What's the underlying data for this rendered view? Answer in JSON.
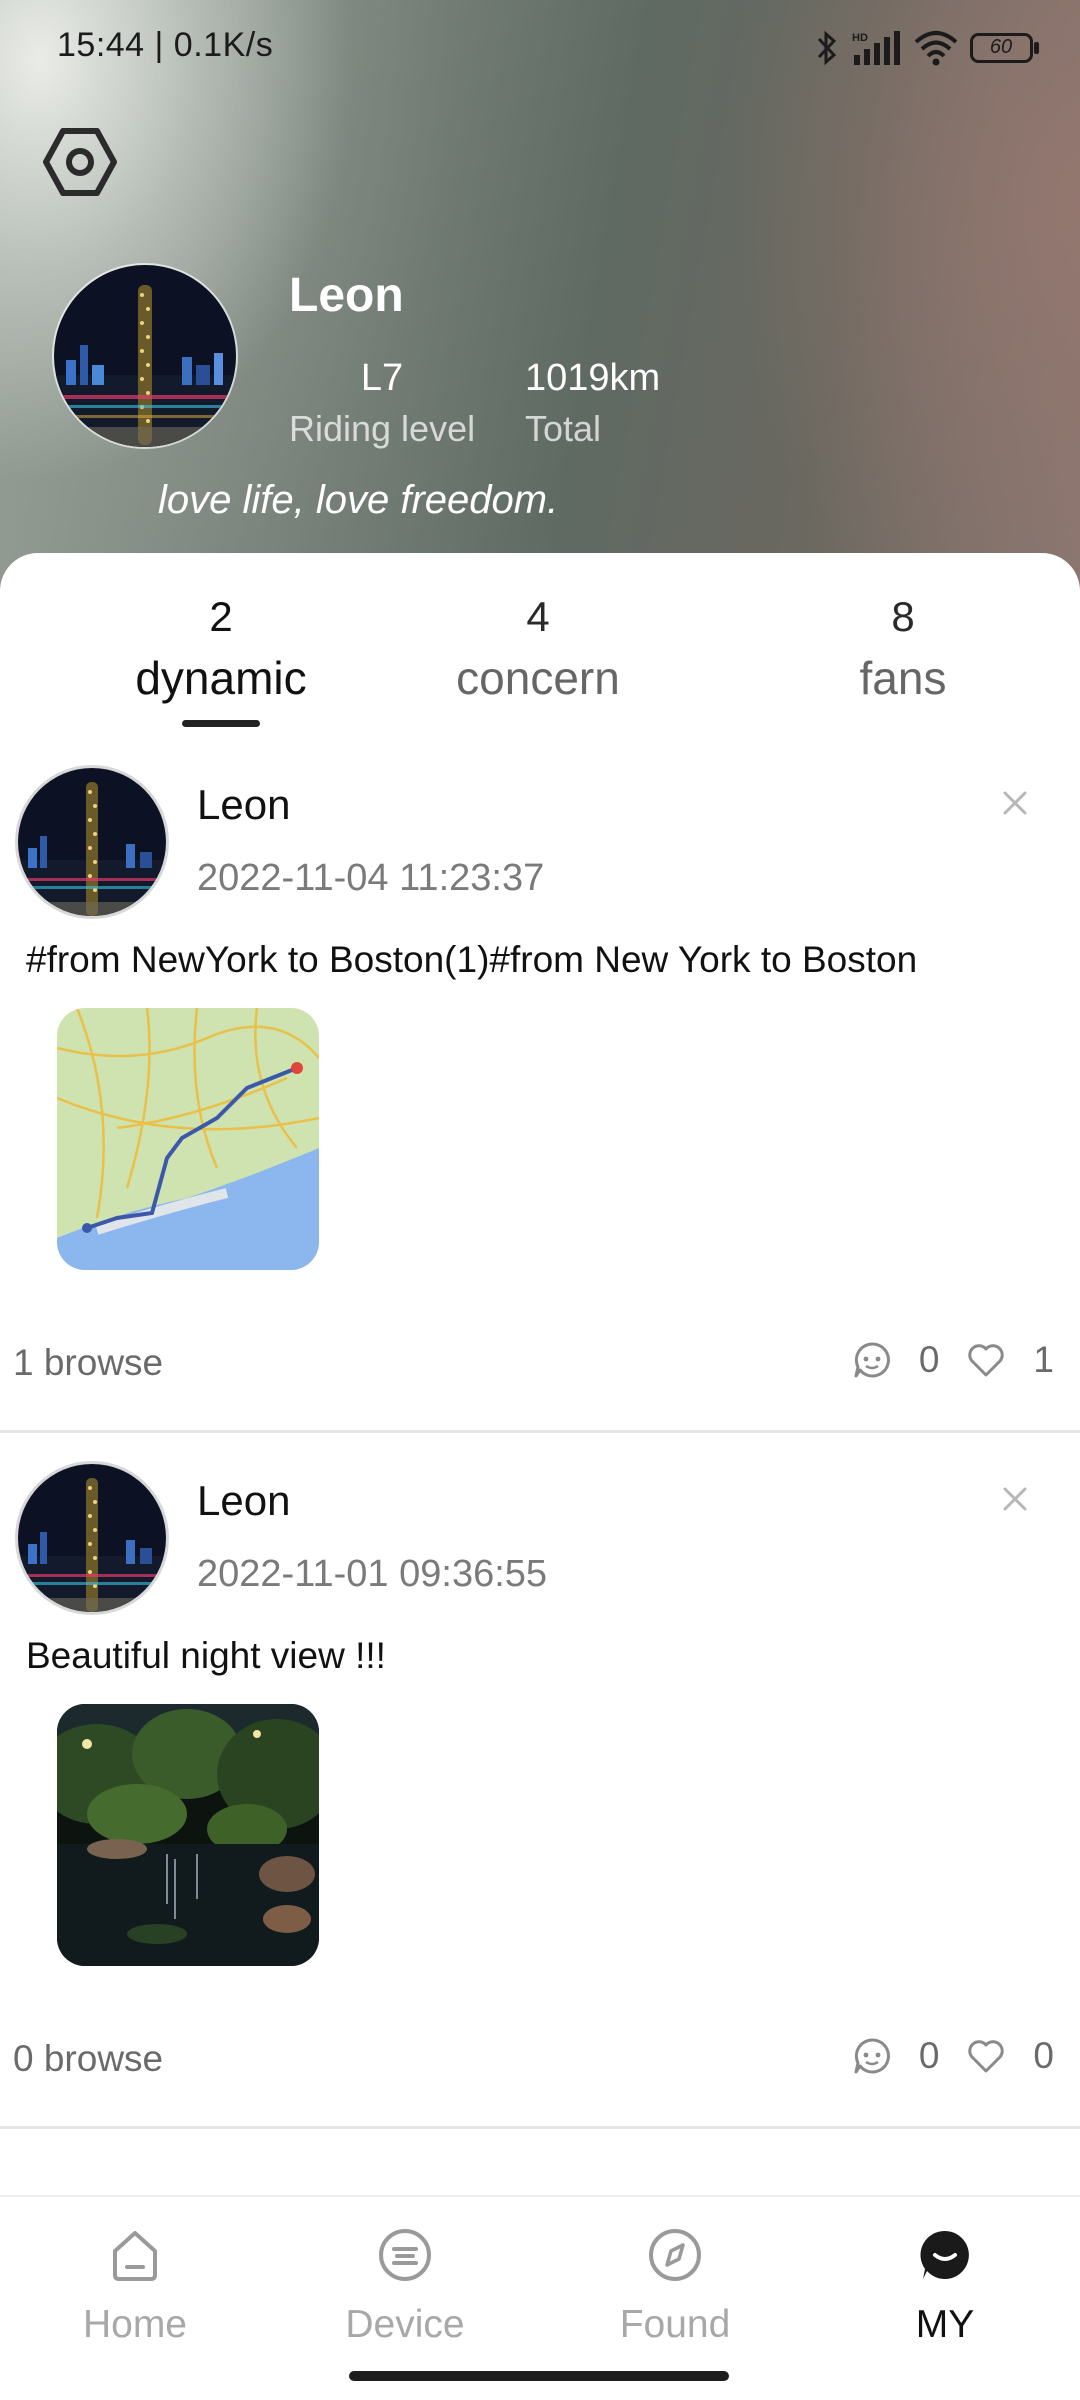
{
  "status_bar": {
    "time_speed": "15:44 | 0.1K/s",
    "battery": "60",
    "icons": [
      "bluetooth-icon",
      "hd-signal-icon",
      "wifi-icon",
      "battery-icon"
    ]
  },
  "header": {
    "settings_icon": "settings-hexagon-icon",
    "name": "Leon",
    "riding_level_value": "L7",
    "riding_level_label": "Riding level",
    "total_value": "1019km",
    "total_label": "Total",
    "bio": "love life, love freedom."
  },
  "tabs": [
    {
      "count": "2",
      "label": "dynamic",
      "active": true
    },
    {
      "count": "4",
      "label": "concern",
      "active": false
    },
    {
      "count": "8",
      "label": "fans",
      "active": false
    }
  ],
  "posts": [
    {
      "user": "Leon",
      "time": "2022-11-04 11:23:37",
      "text": "#from NewYork to Boston(1)#from New York to Boston",
      "image": "route-map-image",
      "browse": "1 browse",
      "comments": "0",
      "likes": "1"
    },
    {
      "user": "Leon",
      "time": "2022-11-01 09:36:55",
      "text": "Beautiful night view !!!",
      "image": "night-garden-pond-image",
      "browse": "0 browse",
      "comments": "0",
      "likes": "0"
    }
  ],
  "bottom_nav": [
    {
      "label": "Home",
      "icon": "home-icon",
      "active": false
    },
    {
      "label": "Device",
      "icon": "device-icon",
      "active": false
    },
    {
      "label": "Found",
      "icon": "compass-icon",
      "active": false
    },
    {
      "label": "MY",
      "icon": "profile-face-icon",
      "active": true
    }
  ],
  "colors": {
    "active_text": "#111111",
    "inactive_nav": "#a8a8a8",
    "secondary_text": "#6a6a6a"
  }
}
